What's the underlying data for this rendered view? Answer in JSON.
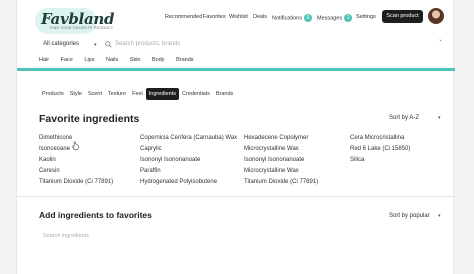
{
  "header": {
    "logo": "Favbland",
    "logo_tagline": "FIND YOUR FAVORITE PRODUCT",
    "nav": {
      "recommended": "Recommended",
      "favorites": "Favorites",
      "wishlist": "Wishlist",
      "deals": "Deals",
      "notifications": "Notifications",
      "notifications_count": "3",
      "messages": "Messages",
      "messages_count": "1",
      "settings": "Settings"
    },
    "scan_button": "Scan product"
  },
  "search": {
    "category": "All categories",
    "placeholder": "Search products, brands"
  },
  "subnav": [
    "Hair",
    "Face",
    "Lips",
    "Nails",
    "Skin",
    "Body",
    "Brands"
  ],
  "tabs": [
    "Products",
    "Style",
    "Scent",
    "Texture",
    "Feel",
    "Ingredients",
    "Credentials",
    "Brands"
  ],
  "active_tab": "Ingredients",
  "favorites": {
    "title": "Favorite ingredients",
    "sort": "Sort by A-Z",
    "columns": [
      [
        "Dimethicone",
        "Isonceoane",
        "Kaolin",
        "Ceresin",
        "Titanium Dioxide (Ci 77891)"
      ],
      [
        "Copernicia Cerifera (Carnauba) Wax",
        "Caprylic",
        "Isononyl Isononanoate",
        "Paraffin",
        "Hydrogenated Polyisobutene"
      ],
      [
        "Hexadecene Copolymer",
        "Microcrystalline Wax",
        "Isononyl Isononanoate",
        "Microcrystalline Wax",
        "Titanium Dioxide (Ci 77891)"
      ],
      [
        "Cera Microcristallina",
        "Red 6 Lake (Ci 15850)",
        "Silica"
      ]
    ]
  },
  "add": {
    "title": "Add ingredients to favorites",
    "sort": "Sort by popular",
    "search_placeholder": "Search ingredients"
  },
  "colors": {
    "accent": "#4fc3b6",
    "dark": "#1e1e1e"
  }
}
